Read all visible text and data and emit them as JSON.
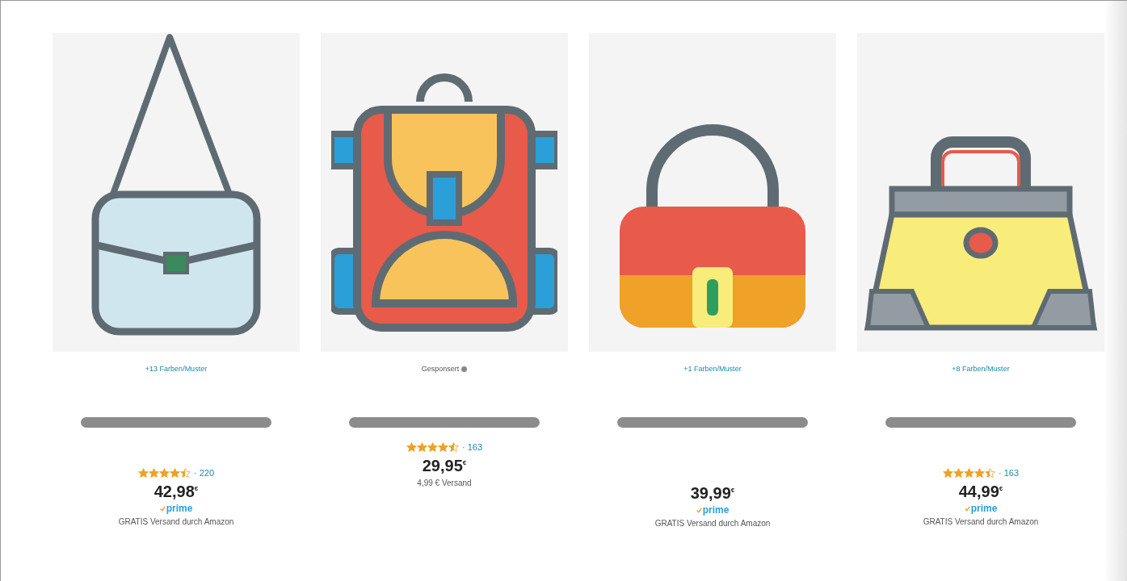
{
  "products": [
    {
      "variants": {
        "kind": "colors",
        "text": "+13 Farben/Muster"
      },
      "rating": {
        "stars": 4.5,
        "count": "· 220"
      },
      "price": "42,98$^{€}$",
      "prime": "prime",
      "shipping": "GRATIS Versand durch Amazon"
    },
    {
      "variants": {
        "kind": "sponsored",
        "text": "Gesponsert"
      },
      "rating": {
        "stars": 4.5,
        "count": "· 163"
      },
      "price": "29,95$^{€}$",
      "shipping": "4,99 € Versand"
    },
    {
      "variants": {
        "kind": "colors",
        "text": "+1 Farben/Muster"
      },
      "price": "39,99$^{€}$",
      "prime": "prime",
      "shipping": "GRATIS Versand durch Amazon"
    },
    {
      "variants": {
        "kind": "colors",
        "text": "+8 Farben/Muster"
      },
      "rating": {
        "stars": 4.5,
        "count": "· 163"
      },
      "price": "44,99$^{€}$",
      "prime": "prime",
      "shipping": "GRATIS Versand durch Amazon"
    }
  ]
}
